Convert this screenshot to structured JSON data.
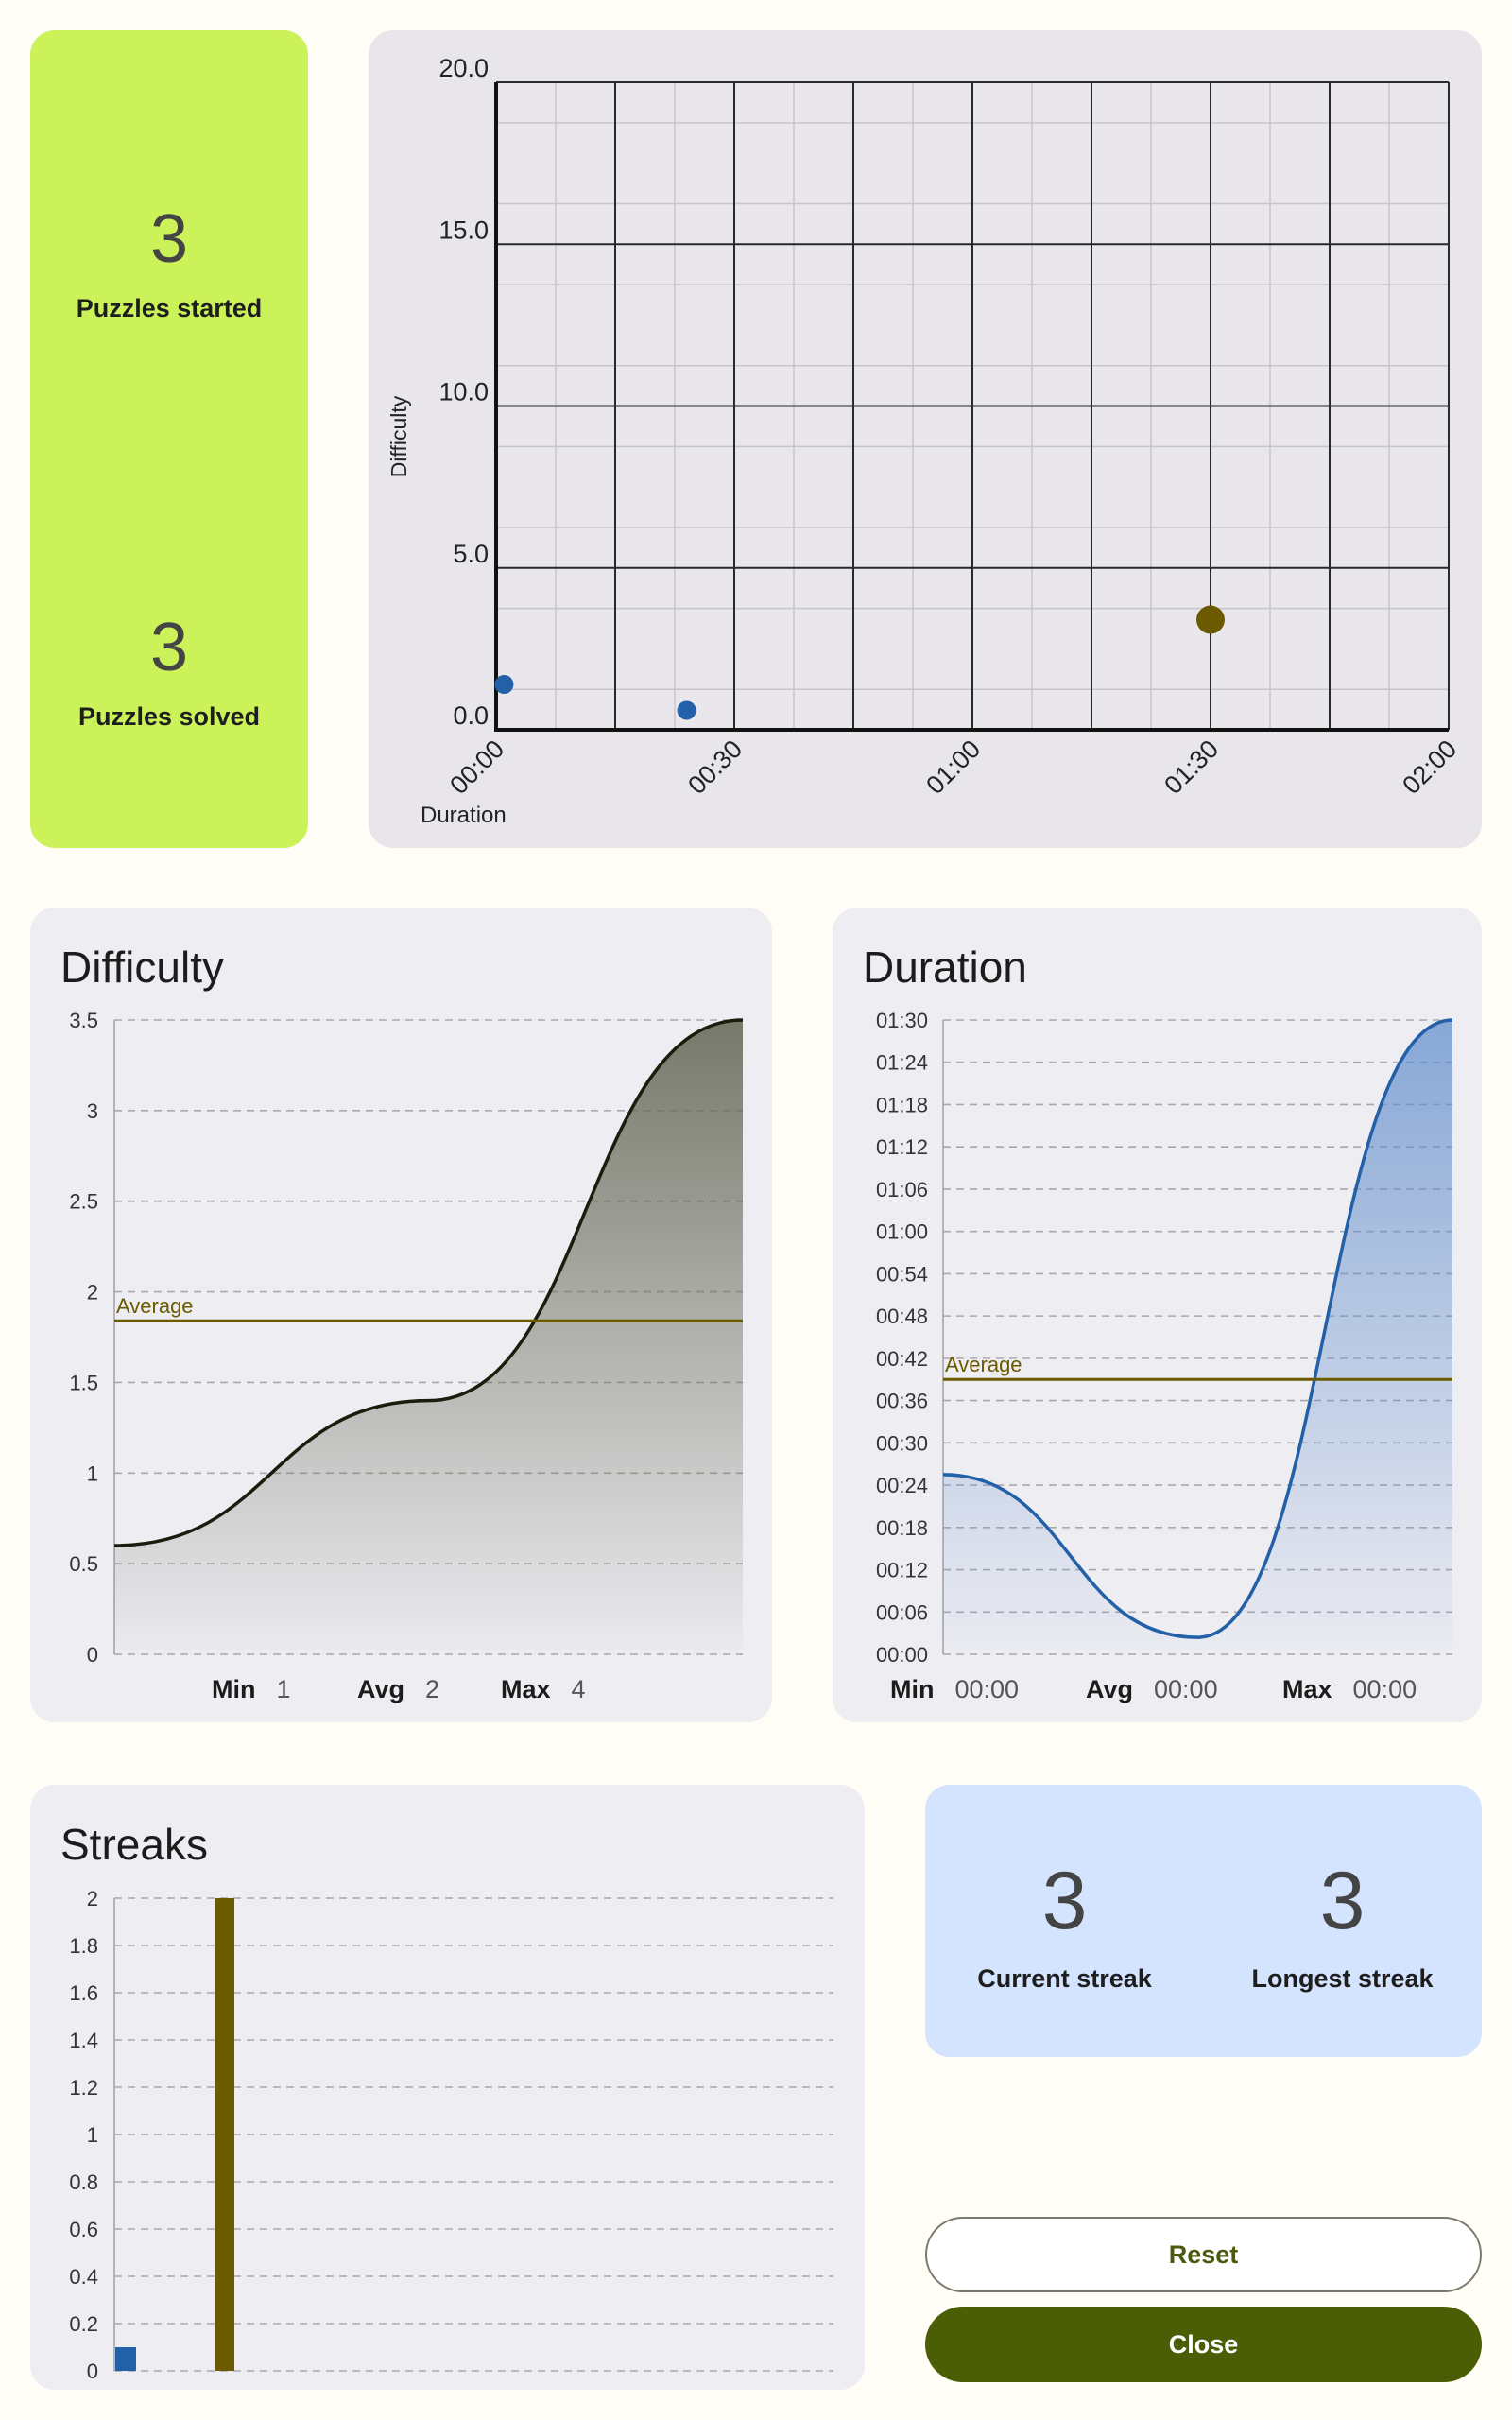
{
  "summary": {
    "puzzles_started": {
      "value": "3",
      "label": "Puzzles started"
    },
    "puzzles_solved": {
      "value": "3",
      "label": "Puzzles solved"
    }
  },
  "scatter": {
    "ylabel": "Difficulty",
    "xlabel": "Duration",
    "y_ticks": [
      "0.0",
      "5.0",
      "10.0",
      "15.0",
      "20.0"
    ],
    "x_ticks": [
      "00:00",
      "00:30",
      "01:00",
      "01:30",
      "02:00"
    ]
  },
  "difficulty": {
    "title": "Difficulty",
    "average_label": "Average",
    "y_ticks": [
      "0",
      "0.5",
      "1",
      "1.5",
      "2",
      "2.5",
      "3",
      "3.5"
    ],
    "stats": {
      "min_label": "Min",
      "min": "1",
      "avg_label": "Avg",
      "avg": "2",
      "max_label": "Max",
      "max": "4"
    }
  },
  "duration": {
    "title": "Duration",
    "average_label": "Average",
    "y_ticks": [
      "00:00",
      "00:06",
      "00:12",
      "00:18",
      "00:24",
      "00:30",
      "00:36",
      "00:42",
      "00:48",
      "00:54",
      "01:00",
      "01:06",
      "01:12",
      "01:18",
      "01:24",
      "01:30"
    ],
    "stats": {
      "min_label": "Min",
      "min": "00:00",
      "avg_label": "Avg",
      "avg": "00:00",
      "max_label": "Max",
      "max": "00:00"
    }
  },
  "streaks": {
    "title": "Streaks",
    "y_ticks": [
      "0",
      "0.2",
      "0.4",
      "0.6",
      "0.8",
      "1",
      "1.2",
      "1.4",
      "1.6",
      "1.8",
      "2"
    ],
    "current": {
      "value": "3",
      "label": "Current streak"
    },
    "longest": {
      "value": "3",
      "label": "Longest streak"
    }
  },
  "buttons": {
    "reset": "Reset",
    "close": "Close"
  },
  "colors": {
    "blue": "#2260a8",
    "olive": "#6b5a00",
    "dark_curve": "#1a1d0c"
  },
  "chart_data": [
    {
      "type": "scatter",
      "xlabel": "Duration",
      "ylabel": "Difficulty",
      "xlim": [
        0,
        120
      ],
      "ylim": [
        0,
        20
      ],
      "x_ticks": [
        "00:00",
        "00:30",
        "01:00",
        "01:30",
        "02:00"
      ],
      "grid": true,
      "series": [
        {
          "color": "#2260a8",
          "x": [
            1,
            24
          ],
          "y": [
            1.4,
            0.6
          ]
        },
        {
          "color": "#6b5a00",
          "x": [
            90
          ],
          "y": [
            3.4
          ]
        }
      ]
    },
    {
      "type": "area",
      "title": "Difficulty",
      "ylim": [
        0,
        3.5
      ],
      "values": [
        0.6,
        1.4,
        3.5
      ],
      "average": 1.84
    },
    {
      "type": "area",
      "title": "Duration",
      "ylim": [
        0,
        90
      ],
      "values": [
        25.5,
        2.4,
        90
      ],
      "average": 39
    },
    {
      "type": "bar",
      "title": "Streaks",
      "ylim": [
        0,
        2
      ],
      "values": [
        0.1,
        2
      ],
      "colors": [
        "#2260a8",
        "#6b5a00"
      ]
    }
  ]
}
